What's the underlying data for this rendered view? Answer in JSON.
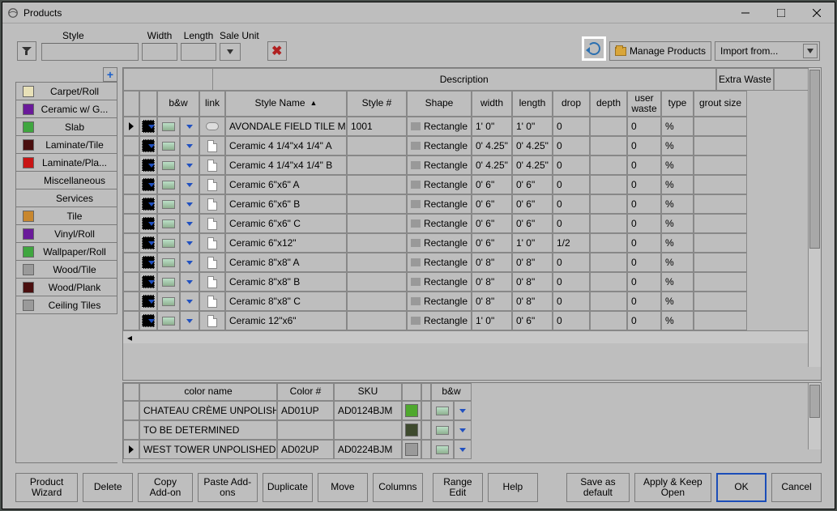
{
  "window": {
    "title": "Products"
  },
  "filters": {
    "style_label": "Style",
    "width_label": "Width",
    "length_label": "Length",
    "saleunit_label": "Sale Unit"
  },
  "toolbar": {
    "manage_label": "Manage Products",
    "import_label": "Import from..."
  },
  "categories": [
    {
      "label": "Carpet/Roll",
      "color": "#E8E1B8"
    },
    {
      "label": "Ceramic w/ G...",
      "color": "#6A1A9A"
    },
    {
      "label": "Slab",
      "color": "#3FA63F"
    },
    {
      "label": "Laminate/Tile",
      "color": "#4A0F0F"
    },
    {
      "label": "Laminate/Pla...",
      "color": "#C81414"
    },
    {
      "label": "Miscellaneous",
      "color": null
    },
    {
      "label": "Services",
      "color": null
    },
    {
      "label": "Tile",
      "color": "#C8872E"
    },
    {
      "label": "Vinyl/Roll",
      "color": "#6A1A9A"
    },
    {
      "label": "Wallpaper/Roll",
      "color": "#3FA63F"
    },
    {
      "label": "Wood/Tile",
      "color": "#9A9A9A"
    },
    {
      "label": "Wood/Plank",
      "color": "#4A0F0F"
    },
    {
      "label": "Ceiling Tiles",
      "color": "#9A9A9A"
    }
  ],
  "grid": {
    "group_description": "Description",
    "group_extra": "Extra Waste",
    "headers": {
      "bw": "b&w",
      "link": "link",
      "stylename": "Style Name",
      "styleno": "Style #",
      "shape": "Shape",
      "width": "width",
      "length": "length",
      "drop": "drop",
      "depth": "depth",
      "uwaste": "user waste",
      "type": "type",
      "grout": "grout size"
    },
    "rows": [
      {
        "sel": true,
        "linkicon": "cloud",
        "name": "AVONDALE FIELD TILE M",
        "no": "1001",
        "shape": "Rectangle",
        "w": "1' 0\"",
        "l": "1' 0\"",
        "drop": "0",
        "depth": "",
        "uw": "0",
        "type": "%",
        "grout": ""
      },
      {
        "linkicon": "doc",
        "name": "Ceramic 4 1/4\"x4 1/4\" A",
        "no": "",
        "shape": "Rectangle",
        "w": "0' 4.25\"",
        "l": "0' 4.25\"",
        "drop": "0",
        "depth": "",
        "uw": "0",
        "type": "%",
        "grout": ""
      },
      {
        "linkicon": "doc",
        "name": "Ceramic 4 1/4\"x4 1/4\" B",
        "no": "",
        "shape": "Rectangle",
        "w": "0' 4.25\"",
        "l": "0' 4.25\"",
        "drop": "0",
        "depth": "",
        "uw": "0",
        "type": "%",
        "grout": ""
      },
      {
        "linkicon": "doc",
        "name": "Ceramic 6\"x6\" A",
        "no": "",
        "shape": "Rectangle",
        "w": "0' 6\"",
        "l": "0' 6\"",
        "drop": "0",
        "depth": "",
        "uw": "0",
        "type": "%",
        "grout": ""
      },
      {
        "linkicon": "doc",
        "name": "Ceramic 6\"x6\" B",
        "no": "",
        "shape": "Rectangle",
        "w": "0' 6\"",
        "l": "0' 6\"",
        "drop": "0",
        "depth": "",
        "uw": "0",
        "type": "%",
        "grout": ""
      },
      {
        "linkicon": "doc",
        "name": "Ceramic 6\"x6\" C",
        "no": "",
        "shape": "Rectangle",
        "w": "0' 6\"",
        "l": "0' 6\"",
        "drop": "0",
        "depth": "",
        "uw": "0",
        "type": "%",
        "grout": ""
      },
      {
        "linkicon": "doc",
        "name": "Ceramic 6\"x12\"",
        "no": "",
        "shape": "Rectangle",
        "w": "0' 6\"",
        "l": "1' 0\"",
        "drop": "1/2",
        "depth": "",
        "uw": "0",
        "type": "%",
        "grout": ""
      },
      {
        "linkicon": "doc",
        "name": "Ceramic 8\"x8\" A",
        "no": "",
        "shape": "Rectangle",
        "w": "0' 8\"",
        "l": "0' 8\"",
        "drop": "0",
        "depth": "",
        "uw": "0",
        "type": "%",
        "grout": ""
      },
      {
        "linkicon": "doc",
        "name": "Ceramic 8\"x8\" B",
        "no": "",
        "shape": "Rectangle",
        "w": "0' 8\"",
        "l": "0' 8\"",
        "drop": "0",
        "depth": "",
        "uw": "0",
        "type": "%",
        "grout": ""
      },
      {
        "linkicon": "doc",
        "name": "Ceramic 8\"x8\" C",
        "no": "",
        "shape": "Rectangle",
        "w": "0' 8\"",
        "l": "0' 8\"",
        "drop": "0",
        "depth": "",
        "uw": "0",
        "type": "%",
        "grout": ""
      },
      {
        "linkicon": "doc",
        "name": "Ceramic 12\"x6\"",
        "no": "",
        "shape": "Rectangle",
        "w": "1' 0\"",
        "l": "0' 6\"",
        "drop": "0",
        "depth": "",
        "uw": "0",
        "type": "%",
        "grout": ""
      }
    ]
  },
  "colors": {
    "headers": {
      "name": "color name",
      "color": "Color #",
      "sku": "SKU",
      "bw": "b&w"
    },
    "rows": [
      {
        "name": "CHATEAU CRÈME UNPOLISHED",
        "color": "AD01UP",
        "sku": "AD0124BJM",
        "sw": "#4FA82E"
      },
      {
        "name": "TO BE DETERMINED",
        "color": "",
        "sku": "",
        "sw": "#3E4A2E"
      },
      {
        "sel": true,
        "name": "WEST TOWER UNPOLISHED",
        "color": "AD02UP",
        "sku": "AD0224BJM",
        "sw": "#9A9A9A"
      }
    ]
  },
  "footer": {
    "wizard": "Product Wizard",
    "delete": "Delete",
    "copyadd": "Copy Add-on",
    "pasteadd": "Paste Add-ons",
    "duplicate": "Duplicate",
    "move": "Move",
    "columns": "Columns",
    "range": "Range Edit",
    "help": "Help",
    "savedef": "Save as default",
    "applykeep": "Apply & Keep Open",
    "ok": "OK",
    "cancel": "Cancel"
  }
}
